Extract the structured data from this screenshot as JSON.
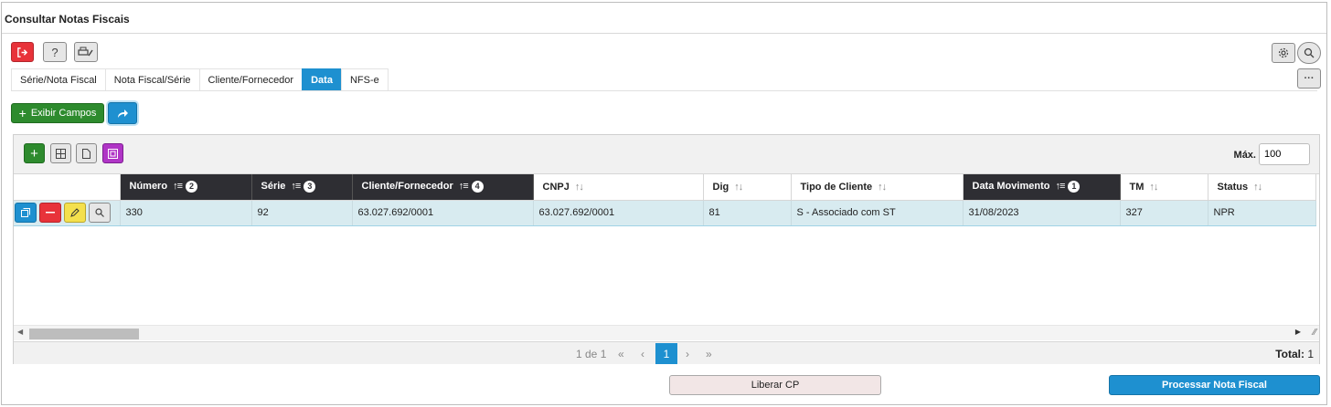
{
  "window": {
    "title": "Consultar Notas Fiscais"
  },
  "toolbar": {
    "exit_icon": "exit-icon",
    "help_label": "?",
    "print_icon": "printer-edit-icon"
  },
  "top_right": {
    "settings_icon": "gear-icon",
    "search_icon": "search-icon",
    "more_label": "···"
  },
  "tabs": [
    {
      "label": "Série/Nota Fiscal",
      "active": false
    },
    {
      "label": "Nota Fiscal/Série",
      "active": false
    },
    {
      "label": "Cliente/Fornecedor",
      "active": false
    },
    {
      "label": "Data",
      "active": true
    },
    {
      "label": "NFS-e",
      "active": false
    }
  ],
  "actions": {
    "show_fields_label": "Exibir Campos"
  },
  "grid": {
    "max_label": "Máx.",
    "max_value": "100",
    "columns": [
      {
        "label": "Número",
        "sorted": true,
        "order": "2"
      },
      {
        "label": "Série",
        "sorted": true,
        "order": "3"
      },
      {
        "label": "Cliente/Fornecedor",
        "sorted": true,
        "order": "4"
      },
      {
        "label": "CNPJ",
        "sorted": false,
        "order": ""
      },
      {
        "label": "Dig",
        "sorted": false,
        "order": ""
      },
      {
        "label": "Tipo de Cliente",
        "sorted": false,
        "order": ""
      },
      {
        "label": "Data Movimento",
        "sorted": true,
        "order": "1"
      },
      {
        "label": "TM",
        "sorted": false,
        "order": ""
      },
      {
        "label": "Status",
        "sorted": false,
        "order": ""
      }
    ],
    "rows": [
      [
        "330",
        "92",
        "63.027.692/0001",
        "63.027.692/0001",
        "81",
        "S - Associado com ST",
        "31/08/2023",
        "327",
        "NPR"
      ]
    ],
    "pager": {
      "page_info": "1 de 1",
      "first": "«",
      "prev": "‹",
      "current": "1",
      "next": "›",
      "last": "»"
    },
    "total_label": "Total:",
    "total_value": "1"
  },
  "footer": {
    "release_label": "Liberar CP",
    "process_label": "Processar Nota Fiscal"
  },
  "colors": {
    "accent": "#1e90d0",
    "danger": "#e8333a",
    "success": "#2e8b2e",
    "header_dark": "#2e2e33",
    "row_selected": "#d8ebf0"
  }
}
